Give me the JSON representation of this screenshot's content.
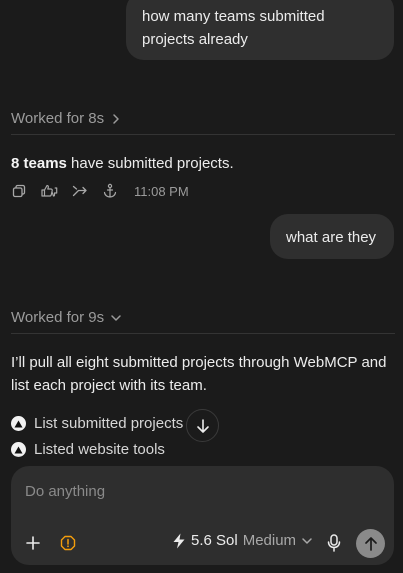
{
  "conversation": {
    "user_message_1": {
      "line_1": "how many teams submitted",
      "line_2": "projects already"
    },
    "worked_1": {
      "label": "Worked for 8s",
      "chevron": "chevron-right-icon"
    },
    "assistant_reply_1": {
      "bold": "8 teams",
      "rest": " have submitted projects.",
      "timestamp": "11:08 PM",
      "action_icons": [
        "copy-icon",
        "thumbs-icons",
        "branch-icon",
        "anchor-icon"
      ]
    },
    "user_message_2": {
      "text": "what are they"
    },
    "worked_2": {
      "label": "Worked for 9s",
      "chevron": "chevron-down-icon"
    },
    "assistant_reply_2": {
      "text": "I’ll pull all eight submitted projects through WebMCP and list each project with its team."
    },
    "tool_steps": [
      {
        "label": "List submitted projects",
        "icon": "triangle-icon"
      },
      {
        "label": "Listed website tools",
        "icon": "triangle-icon"
      }
    ]
  },
  "composer": {
    "placeholder": "Do anything",
    "model": "5.6 Sol",
    "effort": "Medium"
  },
  "colors": {
    "background": "#1b1b1b",
    "bubble": "#2f2f2f",
    "composer": "#2e2e2e",
    "alert": "#f59e0b",
    "send_button": "#8a8a8a"
  }
}
